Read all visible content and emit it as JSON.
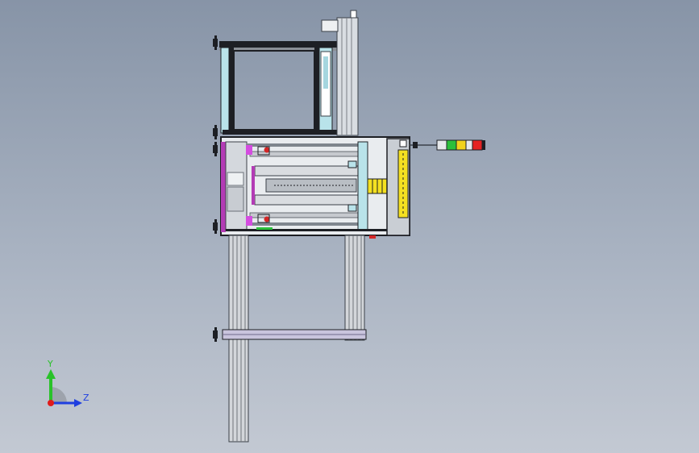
{
  "viewport": {
    "background_top": "#8794a7",
    "background_bottom": "#c3c9d3"
  },
  "triad": {
    "y_label": "Y",
    "z_label": "Z",
    "y_color": "#29c229",
    "z_color": "#1f3fe0",
    "x_color": "#e01b1b"
  },
  "signal_tower": {
    "colors": [
      "#2bbf3a",
      "#f2d21b",
      "#e52222"
    ]
  },
  "colors": {
    "frame_light": "#b9e3ea",
    "frame_dark": "#1d1f24",
    "accent_yellow": "#f4e021",
    "accent_purple": "#b33bb5",
    "accent_magenta": "#d44ce0",
    "accent_red": "#d32727",
    "profile_grey": "#a7abb1"
  }
}
